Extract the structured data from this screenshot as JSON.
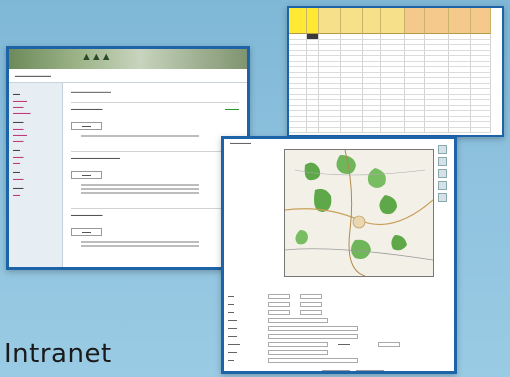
{
  "title": "Intranet",
  "colors": {
    "background": "#8ec2de",
    "window_border": "#1d63a8",
    "spreadsheet_header": "#f7e08a",
    "spreadsheet_highlight": "#ffe933",
    "sidebar_link": "#c0397a",
    "status_ok": "#2f9f2f",
    "status_warn": "#d99a2b",
    "map_green": "#5fa849"
  },
  "screenshots": {
    "spreadsheet": {
      "caption": "spreadsheet-window"
    },
    "portal": {
      "caption": "intranet-portal-window"
    },
    "map": {
      "caption": "map-viewer-window"
    }
  }
}
